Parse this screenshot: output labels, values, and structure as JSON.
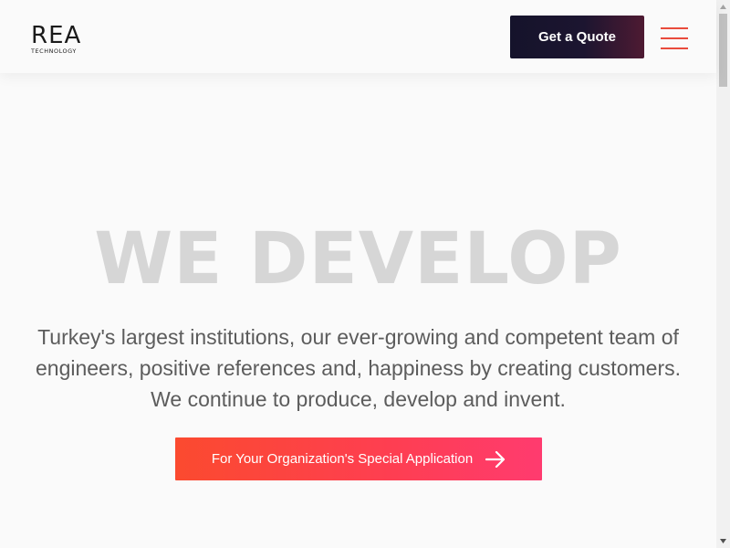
{
  "header": {
    "logo": {
      "mark": "REA",
      "sub": "TECHNOLOGY"
    },
    "quote_button": "Get a Quote",
    "menu_icon": "hamburger-menu-icon"
  },
  "hero": {
    "title": "WE DEVELOP",
    "text": "Turkey's largest institutions, our ever-growing and competent team of engineers, positive references and, happiness by creating customers. We continue to produce, develop and invent.",
    "cta_label": "For Your Organization's Special Application",
    "cta_icon": "arrow-right-icon"
  },
  "colors": {
    "accent": "#fb4a2f",
    "accent_end": "#ff3b6f",
    "dark_button": "#15132b",
    "title_gray": "#d6d6d6",
    "text_gray": "#5c5c5c"
  }
}
